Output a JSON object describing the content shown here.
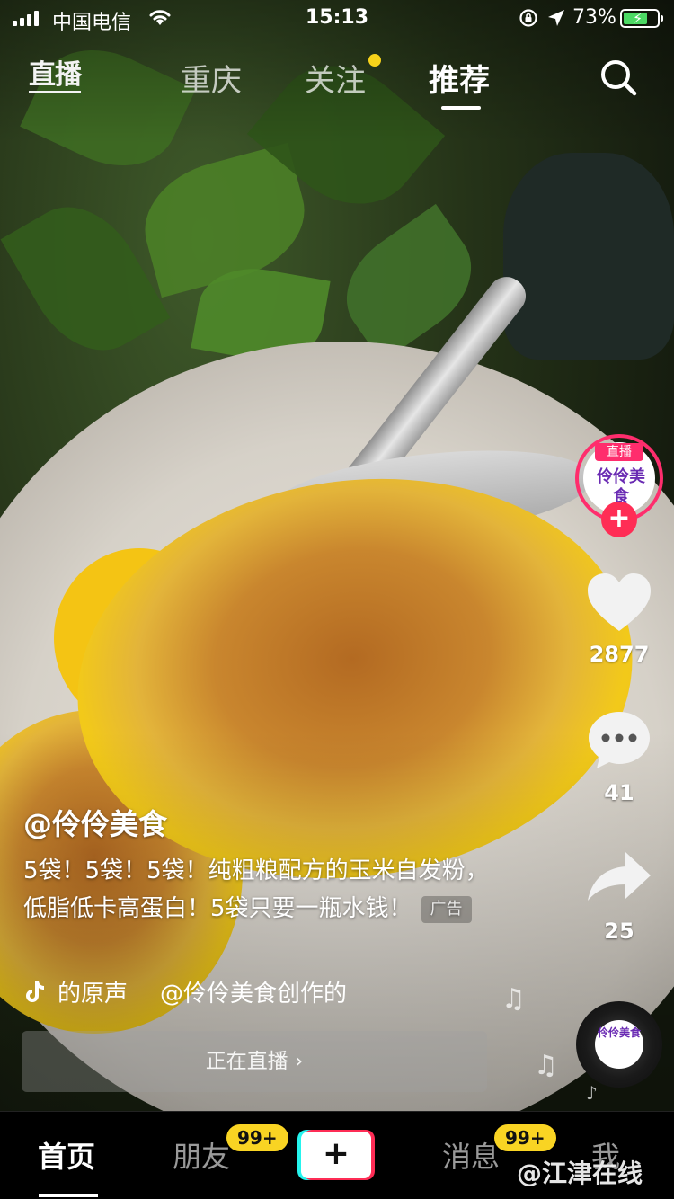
{
  "status_bar": {
    "carrier": "中国电信",
    "time": "15:13",
    "battery_percent": "73%",
    "battery_level": 0.73,
    "icons": [
      "signal-icon",
      "wifi-icon",
      "rotation-lock-icon",
      "location-icon",
      "battery-charging-icon"
    ]
  },
  "top_nav": {
    "live_label": "直播",
    "tabs": [
      {
        "label": "重庆",
        "active": false
      },
      {
        "label": "关注",
        "active": false,
        "has_dot": true
      },
      {
        "label": "推荐",
        "active": true
      }
    ],
    "search_icon": "search-icon",
    "dot_color": "#f7d21a"
  },
  "creator": {
    "avatar_badge": "直播",
    "avatar_logo": "伶伶美食",
    "follow_symbol": "+",
    "ring_color": "#ff2d6d"
  },
  "actions": {
    "likes": "2877",
    "comments": "41",
    "shares": "25"
  },
  "caption": {
    "author": "@伶伶美食",
    "description": "5袋！5袋！5袋！纯粗粮配方的玉米自发粉，低脂低卡高蛋白！5袋只要一瓶水钱！",
    "ad_tag": "广告",
    "music_parts": [
      "的原声",
      "@伶伶美食创作的"
    ]
  },
  "live_bar": {
    "label": "正在直播 ›"
  },
  "music_disc": {
    "label": "伶伶美食"
  },
  "bottom_nav": {
    "items": [
      {
        "label": "首页",
        "active": true
      },
      {
        "label": "朋友",
        "badge": "99+"
      },
      {
        "label": "+",
        "type": "create"
      },
      {
        "label": "消息",
        "badge": "99+"
      },
      {
        "label": "我"
      }
    ],
    "badge_color": "#f9d423"
  },
  "watermark": "@江津在线"
}
